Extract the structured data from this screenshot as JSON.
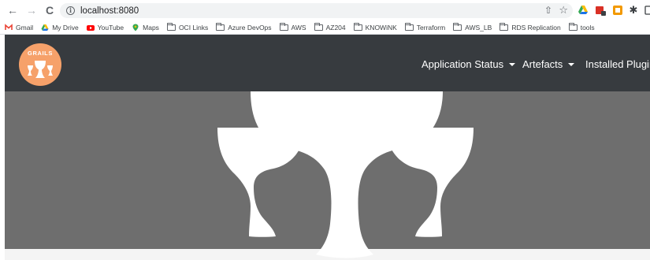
{
  "browser": {
    "url": "localhost:8080",
    "nav": {
      "back_icon": "←",
      "forward_icon": "→",
      "reload_icon": "C"
    }
  },
  "bookmarks": [
    {
      "label": "Gmail",
      "icon": "gmail-icon",
      "color": "#ea4335"
    },
    {
      "label": "My Drive",
      "icon": "drive-icon",
      "color": "#1a73e8"
    },
    {
      "label": "YouTube",
      "icon": "youtube-icon",
      "color": "#ff0000"
    },
    {
      "label": "Maps",
      "icon": "maps-icon",
      "color": "#34a853"
    },
    {
      "label": "OCI Links",
      "icon": "folder-icon"
    },
    {
      "label": "Azure DevOps",
      "icon": "folder-icon"
    },
    {
      "label": "AWS",
      "icon": "folder-icon"
    },
    {
      "label": "AZ204",
      "icon": "folder-icon"
    },
    {
      "label": "KNOWiNK",
      "icon": "folder-icon"
    },
    {
      "label": "Terraform",
      "icon": "folder-icon"
    },
    {
      "label": "AWS_LB",
      "icon": "folder-icon"
    },
    {
      "label": "RDS Replication",
      "icon": "folder-icon"
    },
    {
      "label": "tools",
      "icon": "folder-icon"
    }
  ],
  "app": {
    "logo_text": "GRAILS",
    "menu": [
      {
        "label": "Application Status"
      },
      {
        "label": "Artefacts"
      },
      {
        "label": "Installed Plugins"
      }
    ]
  },
  "colors": {
    "navbar": "#373b3f",
    "logo": "#f6a16a",
    "hero": "#6e6e6e"
  }
}
